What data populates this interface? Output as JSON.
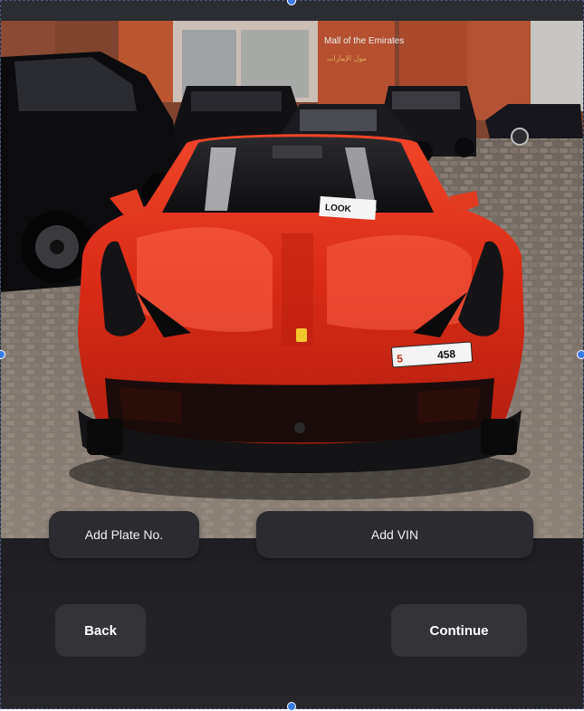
{
  "photo": {
    "description_icon": "car-photo",
    "sign_text": "Mall of the Emirates",
    "sign_arabic": "مول الإمارات",
    "plate_number": "458",
    "plate_code": "5",
    "dealer_card": "LOOK",
    "colors": {
      "car_body": "#e0321c",
      "floor": "#7a7168",
      "wall": "#8c4a32"
    }
  },
  "actions": {
    "add_plate_label": "Add Plate No.",
    "add_vin_label": "Add VIN"
  },
  "nav": {
    "back_label": "Back",
    "continue_label": "Continue"
  }
}
